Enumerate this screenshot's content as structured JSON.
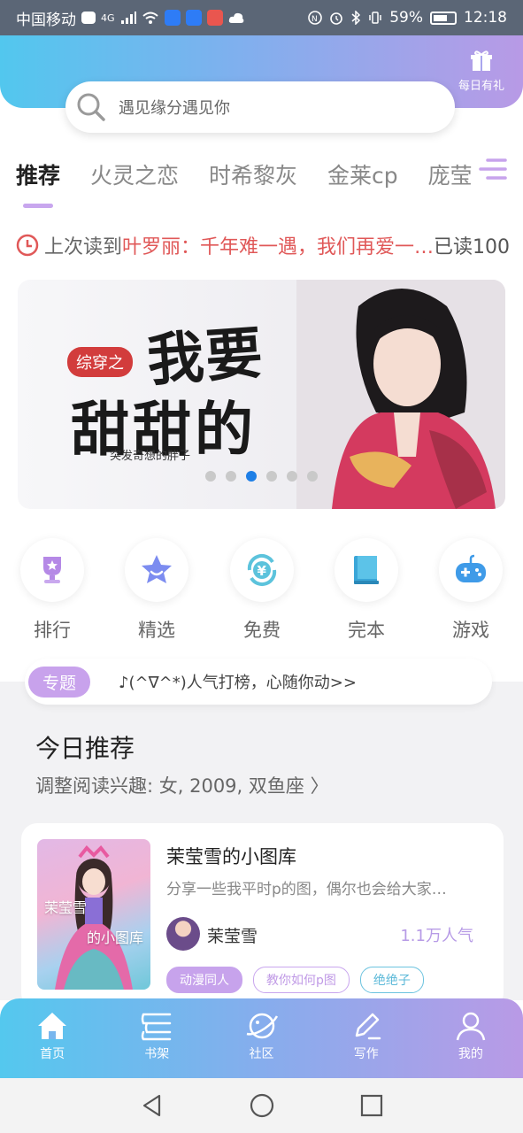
{
  "status_bar": {
    "carrier": "中国移动",
    "network": "4G",
    "battery": "59%",
    "time": "12:18"
  },
  "header": {
    "gift_label": "每日有礼",
    "search_placeholder": "遇见缘分遇见你"
  },
  "tabs": [
    "推荐",
    "火灵之恋",
    "时希黎灰",
    "金莱cp",
    "庞莹"
  ],
  "last_read": {
    "prefix": "上次读到",
    "book": "叶罗丽：千年难一遇，我们再爱一…",
    "progress": "已读100"
  },
  "banner": {
    "tag": "综穿之",
    "title_line1": "我要",
    "title_line2": "甜甜的",
    "author": "突发奇想的胖子",
    "dot_count": 6,
    "active_dot": 2
  },
  "entries": [
    {
      "label": "排行",
      "icon": "trophy-icon"
    },
    {
      "label": "精选",
      "icon": "star-icon"
    },
    {
      "label": "免费",
      "icon": "yen-icon"
    },
    {
      "label": "完本",
      "icon": "book-icon"
    },
    {
      "label": "游戏",
      "icon": "gamepad-icon"
    }
  ],
  "topic": {
    "badge": "专题",
    "text": "♪(^∇^*)人气打榜，心随你动>>"
  },
  "today": {
    "title": "今日推荐",
    "subtitle": "调整阅读兴趣: 女, 2009, 双鱼座 〉"
  },
  "book_card": {
    "cover_text_1": "茉莹雪",
    "cover_text_2": "的小图库",
    "title": "茉莹雪的小图库",
    "description": "分享一些我平时p的图，偶尔也会给大家…",
    "author": "茉莹雪",
    "popularity": "1.1万人气",
    "tags": [
      "动漫同人",
      "教你如何p图",
      "绝绝子"
    ]
  },
  "bottom_nav": [
    {
      "label": "首页",
      "icon": "home-icon"
    },
    {
      "label": "书架",
      "icon": "bookshelf-icon"
    },
    {
      "label": "社区",
      "icon": "planet-icon"
    },
    {
      "label": "写作",
      "icon": "pen-icon"
    },
    {
      "label": "我的",
      "icon": "user-icon"
    }
  ],
  "colors": {
    "accent_purple": "#c8a2ec",
    "header_gradient_start": "#52c7ee",
    "header_gradient_end": "#b89ae6",
    "highlight_red": "#e05858",
    "active_dot": "#1e7fe6"
  }
}
